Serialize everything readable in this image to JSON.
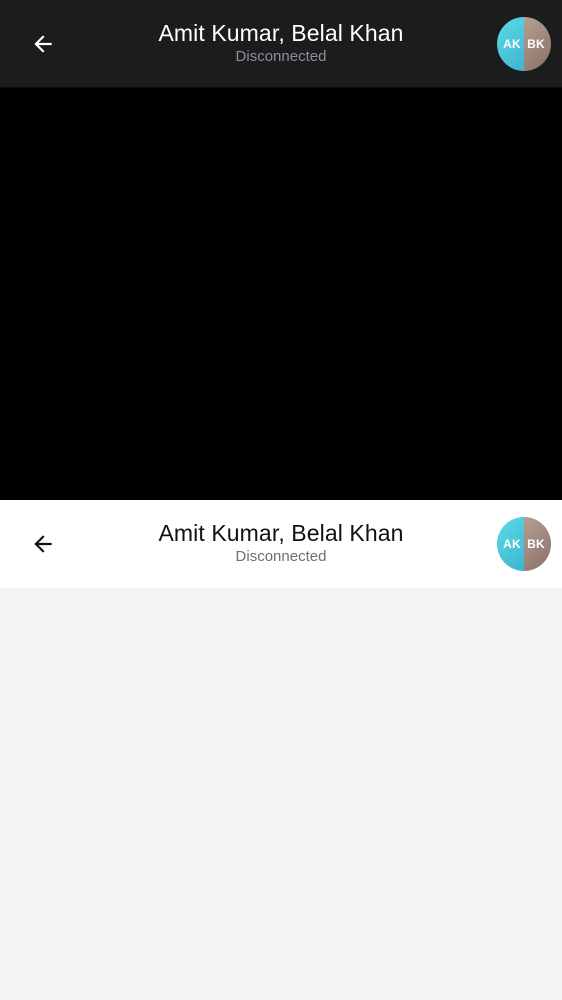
{
  "dark_header": {
    "back_icon": "arrow-left-icon",
    "title": "Amit Kumar, Belal Khan",
    "status": "Disconnected",
    "avatar": {
      "left_initials": "AK",
      "right_initials": "BK"
    }
  },
  "light_header": {
    "back_icon": "arrow-left-icon",
    "title": "Amit Kumar, Belal Khan",
    "status": "Disconnected",
    "avatar": {
      "left_initials": "AK",
      "right_initials": "BK"
    }
  },
  "colors": {
    "dark_header_bg": "#1b1c1e",
    "video_area_bg": "#000000",
    "light_header_bg": "#ffffff",
    "content_bg": "#f5f5f5",
    "avatar_left": "#4cc8dc",
    "avatar_right": "#a08880"
  }
}
